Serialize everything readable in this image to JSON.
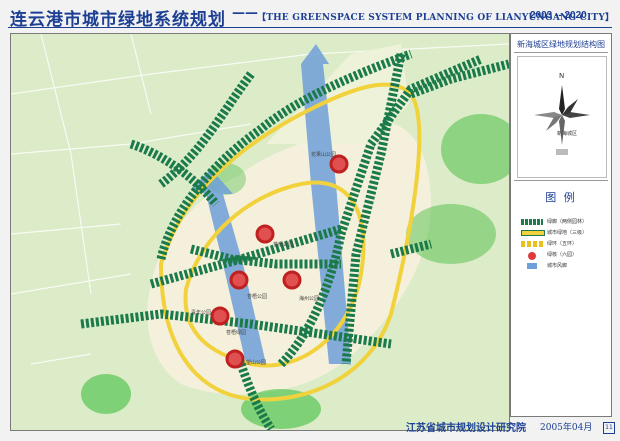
{
  "header": {
    "title": "连云港市城市绿地系统规划",
    "separator": "——",
    "subtitle": "【THE GREENSPACE SYSTEM PLANNING OF LIANYUNGANG CITY】",
    "years": "2003 -- 2020"
  },
  "side_panel": {
    "title": "新海城区绿地规划结构图",
    "north": "N",
    "mini_label": "新海城区",
    "legend_title": "图 例",
    "legend_items": [
      {
        "label": "绿廊（两侧园林）",
        "color": "#1f7a4d"
      },
      {
        "label": "城市绿地（三级）",
        "color": "#f2d23c"
      },
      {
        "label": "绿环（五环）",
        "color": "#e8c020"
      },
      {
        "label": "绿核（六园）",
        "color": "#e03a3a"
      },
      {
        "label": "城市风廊",
        "color": "#6f9fd8"
      }
    ]
  },
  "map": {
    "labels": [
      "花果山公园",
      "苍梧公园",
      "苍梧公园",
      "海州公园",
      "青年公园",
      "苍梧绿园",
      "孔望山公园"
    ],
    "colors": {
      "background": "#d8e8c4",
      "urban": "#f5f0dc",
      "corridor": "#1a7a4a",
      "ring_yellow": "#f2d23c",
      "water_blue": "#6f9fd8",
      "core_red": "#d83232",
      "park_green": "#3fbf3f"
    }
  },
  "footer": {
    "institute": "江苏省城市规划设计研究院",
    "date": "2005年04月",
    "page": "11"
  }
}
